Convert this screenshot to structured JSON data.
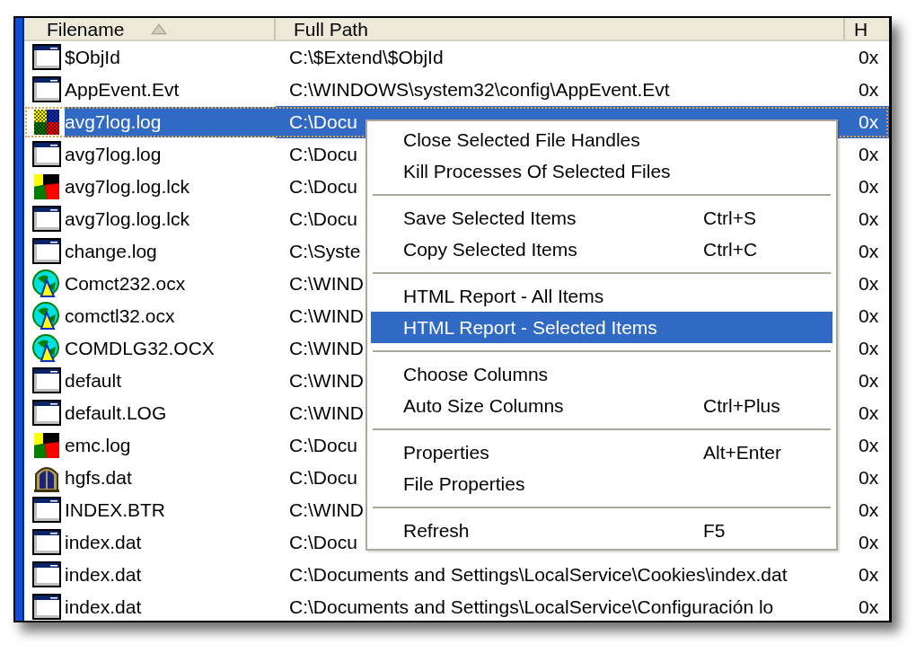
{
  "file_list": {
    "columns": [
      {
        "label": "Filename",
        "sorted": true
      },
      {
        "label": "Full Path"
      },
      {
        "label": "H"
      }
    ],
    "rows": [
      {
        "kind": "window",
        "filename": "$ObjId",
        "path": "C:\\$Extend\\$ObjId",
        "column_3": "0x",
        "selected": false
      },
      {
        "kind": "window",
        "filename": "AppEvent.Evt",
        "path": "C:\\WINDOWS\\system32\\config\\AppEvent.Evt",
        "column_3": "0x",
        "selected": false
      },
      {
        "kind": "checker",
        "filename": "avg7log.log",
        "path": "C:\\Docu",
        "column_3": "0x",
        "selected": true
      },
      {
        "kind": "window",
        "filename": "avg7log.log",
        "path": "C:\\Docu",
        "column_3": "0x",
        "selected": false
      },
      {
        "kind": "flag",
        "filename": "avg7log.log.lck",
        "path": "C:\\Docu",
        "column_3": "0x",
        "selected": false
      },
      {
        "kind": "window",
        "filename": "avg7log.log.lck",
        "path": "C:\\Docu",
        "column_3": "0x",
        "selected": false
      },
      {
        "kind": "window",
        "filename": "change.log",
        "path": "C:\\Syste",
        "column_3": "0x",
        "selected": false
      },
      {
        "kind": "globe",
        "filename": "Comct232.ocx",
        "path": "C:\\WIND",
        "column_3": "0x",
        "selected": false
      },
      {
        "kind": "globe",
        "filename": "comctl32.ocx",
        "path": "C:\\WIND",
        "column_3": "0x",
        "selected": false
      },
      {
        "kind": "globe",
        "filename": "COMDLG32.OCX",
        "path": "C:\\WIND",
        "column_3": "0x",
        "selected": false
      },
      {
        "kind": "window",
        "filename": "default",
        "path": "C:\\WIND",
        "column_3": "0x",
        "selected": false
      },
      {
        "kind": "window",
        "filename": "default.LOG",
        "path": "C:\\WIND",
        "column_3": "0x",
        "selected": false
      },
      {
        "kind": "flag",
        "filename": "emc.log",
        "path": "C:\\Docu",
        "column_3": "0x",
        "selected": false
      },
      {
        "kind": "vault",
        "filename": "hgfs.dat",
        "path": "C:\\Docu",
        "column_3": "0x",
        "selected": false
      },
      {
        "kind": "window",
        "filename": "INDEX.BTR",
        "path": "C:\\WIND",
        "column_3": "0x",
        "selected": false
      },
      {
        "kind": "window",
        "filename": "index.dat",
        "path": "C:\\Docu",
        "column_3": "0x",
        "selected": false
      },
      {
        "kind": "window",
        "filename": "index.dat",
        "path": "C:\\Documents and Settings\\LocalService\\Cookies\\index.dat",
        "column_3": "0x",
        "selected": false
      },
      {
        "kind": "window",
        "filename": "index.dat",
        "path": "C:\\Documents and Settings\\LocalService\\Configuración lo",
        "column_3": "0x",
        "selected": false
      }
    ]
  },
  "context_menu": {
    "items": [
      {
        "kind": "item",
        "label": "Close Selected File Handles",
        "selected": false
      },
      {
        "kind": "item",
        "label": "Kill Processes Of Selected Files",
        "selected": false
      },
      {
        "kind": "separator"
      },
      {
        "kind": "item",
        "label": "Save Selected Items",
        "shortcut": "Ctrl+S",
        "selected": false
      },
      {
        "kind": "item",
        "label": "Copy Selected Items",
        "shortcut": "Ctrl+C",
        "selected": false
      },
      {
        "kind": "separator"
      },
      {
        "kind": "item",
        "label": "HTML Report - All Items",
        "selected": false
      },
      {
        "kind": "item",
        "label": "HTML Report - Selected Items",
        "selected": true
      },
      {
        "kind": "separator"
      },
      {
        "kind": "item",
        "label": "Choose Columns",
        "selected": false
      },
      {
        "kind": "item",
        "label": "Auto Size Columns",
        "shortcut": "Ctrl+Plus",
        "selected": false
      },
      {
        "kind": "separator"
      },
      {
        "kind": "item",
        "label": "Properties",
        "shortcut": "Alt+Enter",
        "selected": false
      },
      {
        "kind": "item",
        "label": "File Properties",
        "selected": false
      },
      {
        "kind": "separator"
      },
      {
        "kind": "item",
        "label": "Refresh",
        "shortcut": "F5",
        "selected": false
      }
    ]
  }
}
